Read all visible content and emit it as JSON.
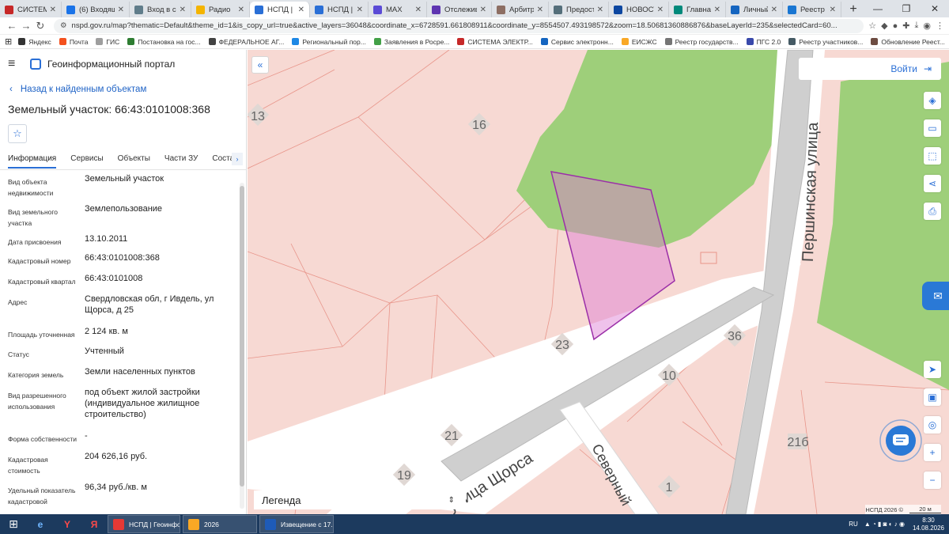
{
  "browser": {
    "tabs": [
      {
        "label": "СИСТЕМА",
        "color": "#c62828"
      },
      {
        "label": "(6) Входящ",
        "color": "#1a73e8"
      },
      {
        "label": "Вход в сис",
        "color": "#607d8b"
      },
      {
        "label": "Радио",
        "color": "#f4b400"
      },
      {
        "label": "НСПД | Ге",
        "color": "#2a6fd6",
        "active": true
      },
      {
        "label": "НСПД | Ф",
        "color": "#2a6fd6"
      },
      {
        "label": "MAX",
        "color": "#5b4bd6"
      },
      {
        "label": "Отслежив",
        "color": "#5e35b1"
      },
      {
        "label": "Арбитраж",
        "color": "#8d6e63"
      },
      {
        "label": "Предоста",
        "color": "#546e7a"
      },
      {
        "label": "НОВОСТИ",
        "color": "#0d47a1"
      },
      {
        "label": "Главная с",
        "color": "#00897b"
      },
      {
        "label": "Личный к",
        "color": "#1565c0"
      },
      {
        "label": "Реестр из",
        "color": "#1976d2"
      }
    ],
    "url": "nspd.gov.ru/map?thematic=Default&theme_id=1&is_copy_url=true&active_layers=36048&coordinate_x=6728591.661808911&coordinate_y=8554507.493198572&zoom=18.50681360886876&baseLayerId=235&selectedCard=60...",
    "bookmarks": [
      {
        "label": "Яндекс",
        "color": "#333333"
      },
      {
        "label": "Почта",
        "color": "#f4511e"
      },
      {
        "label": "ГИС",
        "color": "#9e9e9e"
      },
      {
        "label": "Постановка на гос...",
        "color": "#2e7d32"
      },
      {
        "label": "ФЕДЕРАЛЬНОЕ АГ...",
        "color": "#424242"
      },
      {
        "label": "Региональный пор...",
        "color": "#1e88e5"
      },
      {
        "label": "Заявления в Росре...",
        "color": "#43a047"
      },
      {
        "label": "СИСТЕМА ЭЛЕКТР...",
        "color": "#c62828"
      },
      {
        "label": "Сервис электронн...",
        "color": "#1565c0"
      },
      {
        "label": "ЕИСЖС",
        "color": "#f9a825"
      },
      {
        "label": "Реестр государств...",
        "color": "#757575"
      },
      {
        "label": "ПГС 2.0",
        "color": "#3949ab"
      },
      {
        "label": "Реестр участников...",
        "color": "#455a64"
      },
      {
        "label": "Обновление Реест...",
        "color": "#6d4c41"
      }
    ]
  },
  "panel": {
    "portal_title": "Геоинформационный портал",
    "back_label": "Назад к найденным объектам",
    "object_title": "Земельный участок: 66:43:0101008:368",
    "tabs": [
      "Информация",
      "Сервисы",
      "Объекты",
      "Части ЗУ",
      "Состав"
    ],
    "attributes": [
      {
        "name": "Вид объекта недвижимости",
        "value": "Земельный участок"
      },
      {
        "name": "Вид земельного участка",
        "value": "Землепользование"
      },
      {
        "name": "Дата присвоения",
        "value": "13.10.2011"
      },
      {
        "name": "Кадастровый номер",
        "value": "66:43:0101008:368"
      },
      {
        "name": "Кадастровый квартал",
        "value": "66:43:0101008"
      },
      {
        "name": "Адрес",
        "value": "Свердловская обл, г Ивдель, ул Щорса, д 25"
      },
      {
        "name": "Площадь уточненная",
        "value": "2 124 кв. м"
      },
      {
        "name": "Статус",
        "value": "Учтенный"
      },
      {
        "name": "Категория земель",
        "value": "Земли населенных пунктов"
      },
      {
        "name": "Вид разрешенного использования",
        "value": "под объект жилой застройки (индивидуальное жилищное строительство)"
      },
      {
        "name": "Форма собственности",
        "value": "-"
      },
      {
        "name": "Кадастровая стоимость",
        "value": "204 626,16 руб."
      },
      {
        "name": "Удельный показатель кадастровой",
        "value": "96,34 руб./кв. м"
      }
    ]
  },
  "map": {
    "login_label": "Войти",
    "legend_label": "Легенда",
    "attribution": "НСПД 2026 ©",
    "scale_label": "20 м",
    "street_labels": {
      "main": "Першинская улица",
      "shchorsa": "улица Щорса",
      "severny": "Северный"
    },
    "house_numbers": [
      "13",
      "16",
      "23",
      "36",
      "10",
      "21",
      "21б",
      "19",
      "1"
    ]
  },
  "taskbar": {
    "apps": [
      {
        "label": "НСПД | Геоинфо...",
        "color": "#e53935"
      },
      {
        "label": "2026",
        "color": "#f9a825"
      },
      {
        "label": "Извещение с 17...",
        "color": "#1e5bb8"
      }
    ],
    "lang": "RU",
    "time": "8:30",
    "date": "14.08.2026"
  }
}
